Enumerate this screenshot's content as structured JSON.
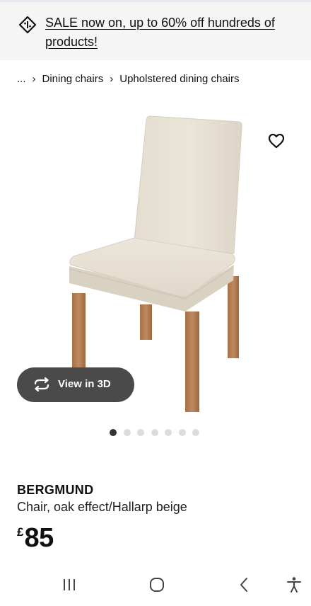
{
  "banner": {
    "text": "SALE now on, up to 60% off hundreds of products!",
    "icon": "sale-tag-icon"
  },
  "breadcrumb": {
    "items": [
      "...",
      "Dining chairs",
      "Upholstered dining chairs"
    ]
  },
  "media": {
    "view_3d_label": "View in 3D",
    "slide_count": 7,
    "active_slide": 1
  },
  "product": {
    "name": "BERGMUND",
    "description": "Chair, oak effect/Hallarp beige",
    "currency": "£",
    "price": "85"
  },
  "colors": {
    "banner_bg": "#f5f5f5",
    "view3d_bg": "#4a4a4a",
    "dot_active": "#333333",
    "dot_inactive": "#dcdcdc"
  },
  "navigation": {
    "icons": [
      "recent-apps-icon",
      "home-icon",
      "back-icon",
      "accessibility-icon"
    ]
  }
}
